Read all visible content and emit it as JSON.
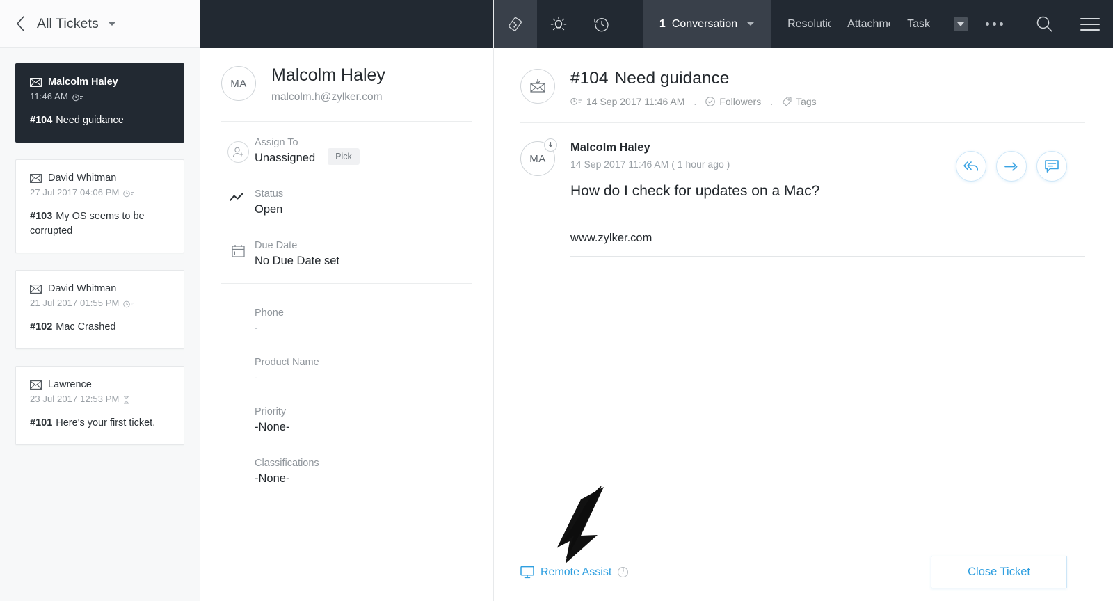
{
  "sidebar": {
    "back_icon": "chevron-left-icon",
    "title": "All Tickets",
    "dropdown_icon": "caret-down-icon",
    "tickets": [
      {
        "channel_icon": "email-icon",
        "name": "Malcolm Haley",
        "time": "11:46 AM",
        "sla_icon": "clock-icon",
        "number": "#104",
        "subject": "Need guidance",
        "selected": true
      },
      {
        "channel_icon": "email-icon",
        "name": "David Whitman",
        "time": "27 Jul 2017 04:06 PM",
        "sla_icon": "clock-icon",
        "number": "#103",
        "subject": "My OS seems to be corrupted",
        "selected": false
      },
      {
        "channel_icon": "email-icon",
        "name": "David Whitman",
        "time": "21 Jul 2017 01:55 PM",
        "sla_icon": "clock-icon",
        "number": "#102",
        "subject": "Mac Crashed",
        "selected": false
      },
      {
        "channel_icon": "email-icon",
        "name": "Lawrence",
        "time": "23 Jul 2017 12:53 PM",
        "sla_icon": "hourglass-icon",
        "number": "#101",
        "subject": "Here's your first ticket.",
        "selected": false
      }
    ]
  },
  "details": {
    "avatar_initials": "MA",
    "contact_name": "Malcolm Haley",
    "contact_email": "malcolm.h@zylker.com",
    "fields": [
      {
        "icon": "add-user-icon",
        "label": "Assign To",
        "value": "Unassigned",
        "chip": "Pick"
      },
      {
        "icon": "trend-icon",
        "label": "Status",
        "value": "Open"
      },
      {
        "icon": "calendar-icon",
        "label": "Due Date",
        "value": "No Due Date set"
      },
      {
        "icon": "",
        "label": "Phone",
        "value": "-"
      },
      {
        "icon": "",
        "label": "Product Name",
        "value": "-"
      },
      {
        "icon": "",
        "label": "Priority",
        "value": "-None-"
      },
      {
        "icon": "",
        "label": "Classifications",
        "value": "-None-"
      }
    ]
  },
  "topnav": {
    "left_icons": [
      {
        "name": "tickets-icon",
        "active": true
      },
      {
        "name": "lightbulb-icon",
        "active": false
      },
      {
        "name": "history-icon",
        "active": false
      }
    ],
    "tabs": [
      {
        "badge": "1",
        "label": "Conversation",
        "active": true,
        "has_caret": true
      },
      {
        "badge": "",
        "label": "Resolutio",
        "active": false,
        "has_caret": false
      },
      {
        "badge": "",
        "label": "Attachme",
        "active": false,
        "has_caret": false
      },
      {
        "badge": "",
        "label": "Task",
        "active": false,
        "has_caret": false
      }
    ],
    "tabs_overflow_icon": "caret-down-icon",
    "more_icon": "more-dots-icon",
    "search_icon": "search-icon",
    "menu_icon": "hamburger-menu-icon"
  },
  "conversation": {
    "head": {
      "channel_icon": "email-incoming-icon",
      "number": "#104",
      "subject": "Need guidance",
      "time_icon": "clock-icon",
      "timestamp": "14 Sep 2017 11:46 AM",
      "separator": ".",
      "followers_icon": "check-circle-icon",
      "followers_label": "Followers",
      "tags_icon": "tag-icon",
      "tags_label": "Tags"
    },
    "actions": [
      {
        "name": "reply-all-button",
        "icon": "reply-all-icon"
      },
      {
        "name": "forward-button",
        "icon": "forward-arrow-icon"
      },
      {
        "name": "comment-button",
        "icon": "comment-icon"
      }
    ],
    "message": {
      "avatar_initials": "MA",
      "badge_icon": "incoming-mail-icon",
      "author": "Malcolm Haley",
      "timestamp": "14 Sep 2017 11:46 AM ( 1 hour ago )",
      "body": "How do I check for updates on a Mac?",
      "signature": "www.zylker.com"
    }
  },
  "bottom": {
    "remote_assist_icon": "monitor-icon",
    "remote_assist_label": "Remote Assist",
    "info_icon": "info-icon",
    "close_ticket_label": "Close Ticket"
  },
  "colors": {
    "nav_dark": "#222932",
    "nav_active": "#39404a",
    "accent_blue": "#2f9fe0",
    "selected_card": "#222932",
    "sidebar_bg": "#f7f8f9"
  }
}
